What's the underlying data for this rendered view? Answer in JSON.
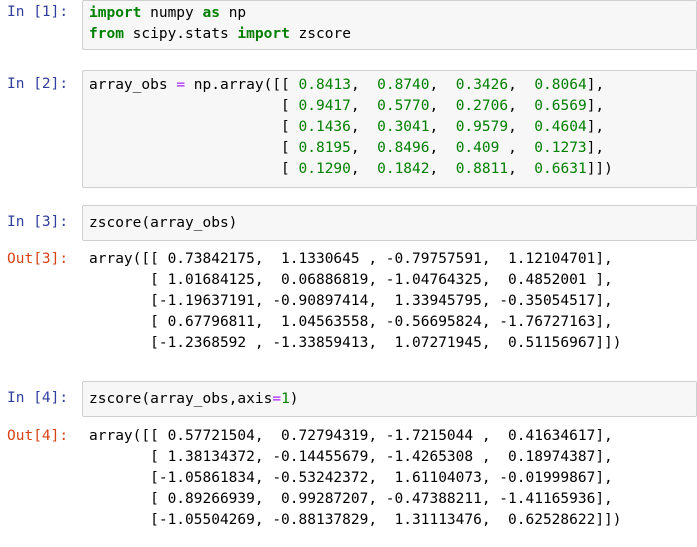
{
  "cells": [
    {
      "kind": "code",
      "prompt": "In [1]:",
      "lines": [
        [
          {
            "t": "import",
            "c": "kw"
          },
          {
            "t": " numpy "
          },
          {
            "t": "as",
            "c": "kw"
          },
          {
            "t": " np"
          }
        ],
        [
          {
            "t": "from",
            "c": "kw"
          },
          {
            "t": " scipy.stats "
          },
          {
            "t": "import",
            "c": "kw"
          },
          {
            "t": " zscore"
          }
        ]
      ]
    },
    {
      "kind": "code",
      "prompt": "In [2]:",
      "lines": [
        [
          {
            "t": "array_obs "
          },
          {
            "t": "=",
            "c": "op"
          },
          {
            "t": " np.array([[ "
          },
          {
            "t": "0.8413",
            "c": "num"
          },
          {
            "t": ",  "
          },
          {
            "t": "0.8740",
            "c": "num"
          },
          {
            "t": ",  "
          },
          {
            "t": "0.3426",
            "c": "num"
          },
          {
            "t": ",  "
          },
          {
            "t": "0.8064",
            "c": "num"
          },
          {
            "t": "],"
          }
        ],
        [
          {
            "t": "                      [ "
          },
          {
            "t": "0.9417",
            "c": "num"
          },
          {
            "t": ",  "
          },
          {
            "t": "0.5770",
            "c": "num"
          },
          {
            "t": ",  "
          },
          {
            "t": "0.2706",
            "c": "num"
          },
          {
            "t": ",  "
          },
          {
            "t": "0.6569",
            "c": "num"
          },
          {
            "t": "],"
          }
        ],
        [
          {
            "t": "                      [ "
          },
          {
            "t": "0.1436",
            "c": "num"
          },
          {
            "t": ",  "
          },
          {
            "t": "0.3041",
            "c": "num"
          },
          {
            "t": ",  "
          },
          {
            "t": "0.9579",
            "c": "num"
          },
          {
            "t": ",  "
          },
          {
            "t": "0.4604",
            "c": "num"
          },
          {
            "t": "],"
          }
        ],
        [
          {
            "t": "                      [ "
          },
          {
            "t": "0.8195",
            "c": "num"
          },
          {
            "t": ",  "
          },
          {
            "t": "0.8496",
            "c": "num"
          },
          {
            "t": ",  "
          },
          {
            "t": "0.409",
            "c": "num"
          },
          {
            "t": " ,  "
          },
          {
            "t": "0.1273",
            "c": "num"
          },
          {
            "t": "],"
          }
        ],
        [
          {
            "t": "                      [ "
          },
          {
            "t": "0.1290",
            "c": "num"
          },
          {
            "t": ",  "
          },
          {
            "t": "0.1842",
            "c": "num"
          },
          {
            "t": ",  "
          },
          {
            "t": "0.8811",
            "c": "num"
          },
          {
            "t": ",  "
          },
          {
            "t": "0.6631",
            "c": "num"
          },
          {
            "t": "]])"
          }
        ]
      ]
    },
    {
      "kind": "code",
      "prompt": "In [3]:",
      "lines": [
        [
          {
            "t": "zscore(array_obs)"
          }
        ]
      ]
    },
    {
      "kind": "output",
      "prompt": "Out[3]:",
      "lines": [
        "array([[ 0.73842175,  1.1330645 , -0.79757591,  1.12104701],",
        "       [ 1.01684125,  0.06886819, -1.04764325,  0.4852001 ],",
        "       [-1.19637191, -0.90897414,  1.33945795, -0.35054517],",
        "       [ 0.67796811,  1.04563558, -0.56695824, -1.76727163],",
        "       [-1.2368592 , -1.33859413,  1.07271945,  0.51156967]])"
      ]
    },
    {
      "kind": "code",
      "prompt": "In [4]:",
      "lines": [
        [
          {
            "t": "zscore(array_obs,axis"
          },
          {
            "t": "=",
            "c": "op"
          },
          {
            "t": "1",
            "c": "num"
          },
          {
            "t": ")"
          }
        ]
      ]
    },
    {
      "kind": "output",
      "prompt": "Out[4]:",
      "lines": [
        "array([[ 0.57721504,  0.72794319, -1.7215044 ,  0.41634617],",
        "       [ 1.38134372, -0.14455679, -1.4265308 ,  0.18974387],",
        "       [-1.05861834, -0.53242372,  1.61104073, -0.01999867],",
        "       [ 0.89266939,  0.99287207, -0.47388211, -1.41165936],",
        "       [-1.05504269, -0.88137829,  1.31113476,  0.62528622]])"
      ]
    }
  ]
}
